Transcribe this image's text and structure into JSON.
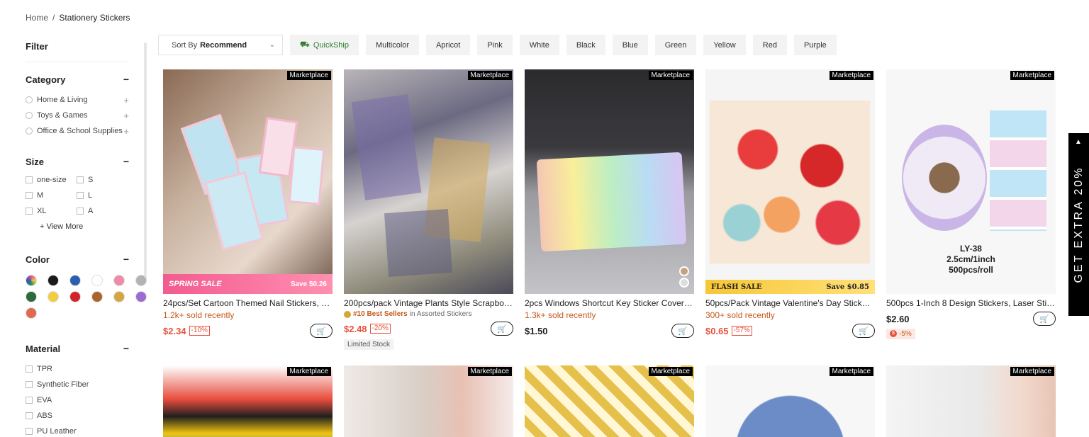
{
  "breadcrumb": {
    "home": "Home",
    "sep": "/",
    "current": "Stationery Stickers"
  },
  "filter": {
    "title": "Filter",
    "category": {
      "label": "Category",
      "items": [
        "Home & Living",
        "Toys & Games",
        "Office & School Supplies"
      ]
    },
    "size": {
      "label": "Size",
      "items": [
        "one-size",
        "S",
        "M",
        "L",
        "XL",
        "A"
      ],
      "view_more": "+ View More"
    },
    "color": {
      "label": "Color",
      "swatches": [
        "#e04f9c",
        "#1a1a1a",
        "#2a5fb0",
        "#ffffff",
        "#ef8aa8",
        "#b3b3b3",
        "#2f6a3d",
        "#f2cd3f",
        "#d1232a",
        "#a8642a",
        "#d4a640",
        "#9b6bd1",
        "#e06a4f"
      ]
    },
    "material": {
      "label": "Material",
      "items": [
        "TPR",
        "Synthetic Fiber",
        "EVA",
        "ABS",
        "PU Leather"
      ]
    }
  },
  "toolbar": {
    "sort_label": "Sort By",
    "sort_value": "Recommend",
    "chips": [
      "QuickShip",
      "Multicolor",
      "Apricot",
      "Pink",
      "White",
      "Black",
      "Blue",
      "Green",
      "Yellow",
      "Red",
      "Purple"
    ]
  },
  "marketplace_label": "Marketplace",
  "side_tab": "GET EXTRA 20%",
  "products": [
    {
      "title": "24pcs/Set Cartoon Themed Nail Stickers, Sui...",
      "sold": "1.2k+ sold recently",
      "price": "$2.34",
      "discount": "-10%",
      "banner": "SPRING SALE",
      "banner_save": "Save $0.26"
    },
    {
      "title": "200pcs/pack Vintage Plants Style Scrapbook...",
      "best_rank": "#10 Best Sellers",
      "best_in": "in Assorted Stickers",
      "price": "$2.48",
      "discount": "-20%",
      "limited": "Limited Stock"
    },
    {
      "title": "2pcs Windows Shortcut Key Sticker Cover D...",
      "sold": "1.3k+ sold recently",
      "price": "$1.50"
    },
    {
      "title": "50pcs/Pack Vintage Valentine's Day Stickers ...",
      "sold": "300+ sold recently",
      "price": "$0.65",
      "discount": "-57%",
      "banner": "FLASH SALE",
      "banner_save": "Save $0.85"
    },
    {
      "title": "500pcs 1-Inch 8 Design Stickers, Laser Stick...",
      "price": "$2.60",
      "extra_discount": "-5%",
      "img_label_1": "LY-38",
      "img_label_2": "2.5cm/1inch",
      "img_label_3": "500pcs/roll"
    }
  ]
}
